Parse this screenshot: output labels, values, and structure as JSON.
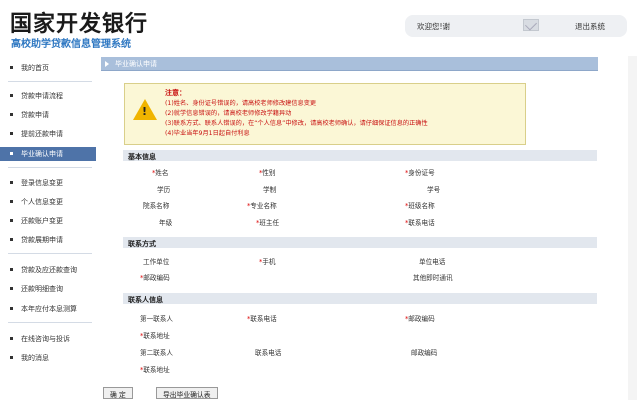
{
  "header": {
    "title": "国家开发银行",
    "subtitle": "高校助学贷款信息管理系统",
    "welcome": "欢迎您!谢",
    "logout": "退出系统"
  },
  "sidebar": {
    "items": [
      {
        "label": "我的首页"
      },
      {
        "label": "贷款申请流程"
      },
      {
        "label": "贷款申请"
      },
      {
        "label": "提前还款申请"
      },
      {
        "label": "毕业确认申请"
      },
      {
        "label": "登录信息变更"
      },
      {
        "label": "个人信息变更"
      },
      {
        "label": "还款账户变更"
      },
      {
        "label": "贷款展期申请"
      },
      {
        "label": "贷款及应还款查询"
      },
      {
        "label": "还款明细查询"
      },
      {
        "label": "本年应付本息测算"
      },
      {
        "label": "在线咨询与投诉"
      },
      {
        "label": "我的消息"
      }
    ],
    "active_index": 4
  },
  "page": {
    "title": "毕业确认申请"
  },
  "notice": {
    "title": "注意：",
    "lines": [
      "(1)姓名、身份证号错误的，请高校老师修改建信息变更",
      "(2)就学信息错误的，请高校老师修改学籍异动",
      "(3)联系方式、联系人错误的，在“个人信息”中修改，请高校老师确认，请仔细保证信息的正确性",
      "(4)毕业当年9月1日起自付利息"
    ]
  },
  "sections": {
    "basic": {
      "title": "基本信息",
      "fields": [
        "姓名",
        "性别",
        "身份证号",
        "学历",
        "学制",
        "学号",
        "院系名称",
        "专业名称",
        "班级名称",
        "年级",
        "班主任",
        "联系电话"
      ]
    },
    "contact": {
      "title": "联系方式",
      "fields": [
        "工作单位",
        "手机",
        "单位电话",
        "邮政编码",
        "其他即时通讯"
      ]
    },
    "person": {
      "title": "联系人信息",
      "fields": [
        "第一联系人",
        "联系电话",
        "邮政编码",
        "联系地址",
        "第二联系人",
        "联系电话",
        "邮政编码",
        "联系地址"
      ]
    }
  },
  "buttons": {
    "confirm": "确 定",
    "export": "导出毕业确认表"
  }
}
